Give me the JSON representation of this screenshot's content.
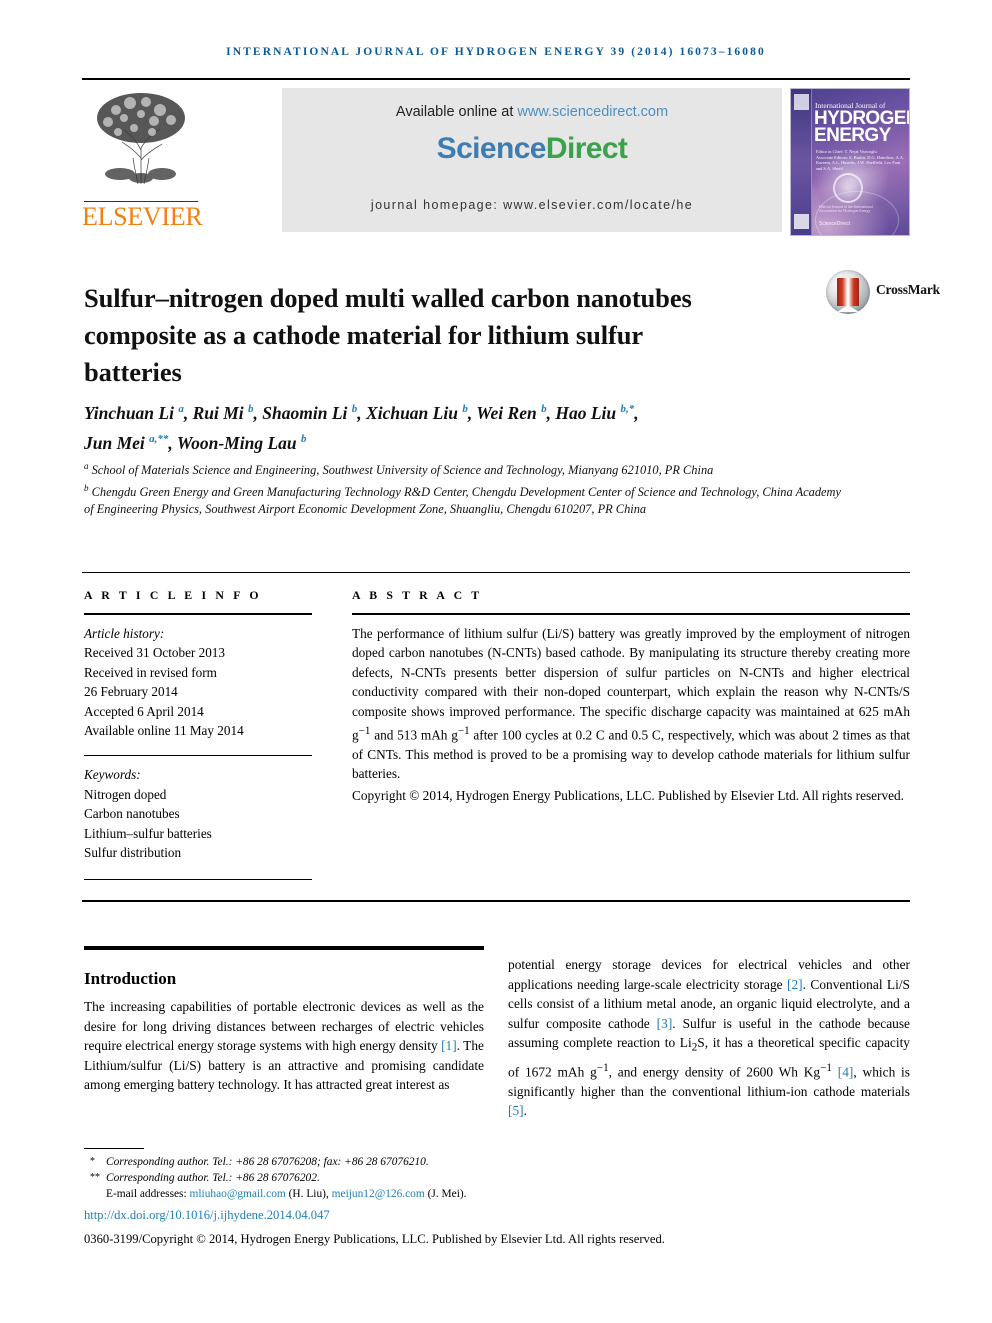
{
  "running_head": "INTERNATIONAL JOURNAL OF HYDROGEN ENERGY 39 (2014) 16073–16080",
  "masthead": {
    "publisher": "ELSEVIER",
    "available_prefix": "Available online at ",
    "available_link": "www.sciencedirect.com",
    "sciencedirect_part1": "Science",
    "sciencedirect_part2": "Direct",
    "journal_homepage": "journal homepage: www.elsevier.com/locate/he",
    "cover": {
      "line1": "International Journal of",
      "line2": "HYDROGEN",
      "line3": "ENERGY",
      "editors": "Editor in Chief: T. Nejat Veziroglu\nAssociate Editors: S. Bashir, D.G. Hamilton, A.A. Kareem, A.L. Hmedix, J.W. Sheffield, Leo Funt and S.A. Sherif",
      "sciencedirect_tag": "ScienceDirect",
      "society_tag": "Official Journal of the International Association for Hydrogen Energy"
    }
  },
  "crossmark": {
    "label": "CrossMark"
  },
  "article": {
    "title": "Sulfur–nitrogen doped multi walled carbon nanotubes composite as a cathode material for lithium sulfur batteries",
    "authors_line1": "Yinchuan Li a, Rui Mi b, Shaomin Li b, Xichuan Liu b, Wei Ren b, Hao Liu b,*,",
    "authors_line2": "Jun Mei a,**, Woon-Ming Lau b",
    "affiliation_a": "School of Materials Science and Engineering, Southwest University of Science and Technology, Mianyang 621010, PR China",
    "affiliation_b": "Chengdu Green Energy and Green Manufacturing Technology R&D Center, Chengdu Development Center of Science and Technology, China Academy of Engineering Physics, Southwest Airport Economic Development Zone, Shuangliu, Chengdu 610207, PR China"
  },
  "article_info": {
    "heading": "A R T I C L E   I N F O",
    "history_label": "Article history:",
    "history": [
      "Received 31 October 2013",
      "Received in revised form",
      "26 February 2014",
      "Accepted 6 April 2014",
      "Available online 11 May 2014"
    ],
    "keywords_label": "Keywords:",
    "keywords": [
      "Nitrogen doped",
      "Carbon nanotubes",
      "Lithium–sulfur batteries",
      "Sulfur distribution"
    ]
  },
  "abstract": {
    "heading": "A B S T R A C T",
    "body": "The performance of lithium sulfur (Li/S) battery was greatly improved by the employment of nitrogen doped carbon nanotubes (N-CNTs) based cathode. By manipulating its structure thereby creating more defects, N-CNTs presents better dispersion of sulfur particles on N-CNTs and higher electrical conductivity compared with their non-doped counterpart, which explain the reason why N-CNTs/S composite shows improved performance. The specific discharge capacity was maintained at 625 mAh g−1 and 513 mAh g−1 after 100 cycles at 0.2 C and 0.5 C, respectively, which was about 2 times as that of CNTs. This method is proved to be a promising way to develop cathode materials for lithium sulfur batteries.",
    "copyright": "Copyright © 2014, Hydrogen Energy Publications, LLC. Published by Elsevier Ltd. All rights reserved."
  },
  "introduction": {
    "heading": "Introduction",
    "left_text": "The increasing capabilities of portable electronic devices as well as the desire for long driving distances between recharges of electric vehicles require electrical energy storage systems with high energy density [1]. The Lithium/sulfur (Li/S) battery is an attractive and promising candidate among emerging battery technology. It has attracted great interest as",
    "right_text": "potential energy storage devices for electrical vehicles and other applications needing large-scale electricity storage [2]. Conventional Li/S cells consist of a lithium metal anode, an organic liquid electrolyte, and a sulfur composite cathode [3]. Sulfur is useful in the cathode because assuming complete reaction to Li2S, it has a theoretical specific capacity of 1672 mAh g−1, and energy density of 2600 Wh Kg−1 [4], which is significantly higher than the conventional lithium-ion cathode materials [5]."
  },
  "footnotes": {
    "note1_mark": "*",
    "note1": "Corresponding author. Tel.: +86 28 67076208; fax: +86 28 67076210.",
    "note2_mark": "**",
    "note2": "Corresponding author. Tel.: +86 28 67076202.",
    "email_label": "E-mail addresses:",
    "email1": "mliuhao@gmail.com",
    "email1_who": "(H. Liu),",
    "email2": "meijun12@126.com",
    "email2_who": "(J. Mei).",
    "doi": "http://dx.doi.org/10.1016/j.ijhydene.2014.04.047",
    "issn_copyright": "0360-3199/Copyright © 2014, Hydrogen Energy Publications, LLC. Published by Elsevier Ltd. All rights reserved."
  },
  "colors": {
    "journal_blue": "#0a5a9c",
    "link_blue": "#1e7fb5",
    "elsevier_orange": "#F2810C",
    "sciencedirect_green": "#3aa24b",
    "sciencedirect_blue": "#3e7cb1",
    "masthead_grey": "#e6e6e6"
  }
}
